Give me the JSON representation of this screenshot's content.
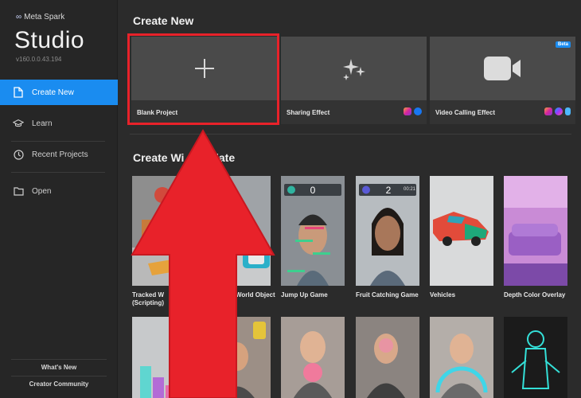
{
  "sidebar": {
    "brand": "Meta Spark",
    "title": "Studio",
    "version": "v160.0.0.43.194",
    "items": [
      {
        "label": "Create New",
        "icon": "document-icon"
      },
      {
        "label": "Learn",
        "icon": "graduation-cap-icon"
      },
      {
        "label": "Recent Projects",
        "icon": "clock-icon"
      },
      {
        "label": "Open",
        "icon": "folder-icon"
      }
    ],
    "footer": [
      {
        "label": "What's New"
      },
      {
        "label": "Creator Community"
      }
    ]
  },
  "main": {
    "create_new_title": "Create New",
    "create_new_cards": [
      {
        "label": "Blank Project",
        "icon": "plus-icon"
      },
      {
        "label": "Sharing Effect",
        "icon": "sparkles-icon",
        "badges": [
          "instagram-icon",
          "facebook-icon"
        ]
      },
      {
        "label": "Video Calling Effect",
        "icon": "video-camera-icon",
        "badge": "Beta",
        "badges": [
          "instagram-icon",
          "messenger-icon",
          "portal-icon"
        ]
      }
    ],
    "template_title": "Create With Template",
    "template_title_visible": "Create Wi",
    "template_title_visible_tail": "plate",
    "templates": [
      {
        "label": "Tracked W",
        "label2": "(Scripting)"
      },
      {
        "label": "World Object"
      },
      {
        "label": "Jump Up Game",
        "score": "0"
      },
      {
        "label": "Fruit Catching Game",
        "score": "2",
        "timer": "00:21"
      },
      {
        "label": "Vehicles"
      },
      {
        "label": "Depth Color Overlay"
      }
    ]
  },
  "colors": {
    "accent": "#1a8cf0",
    "highlight": "#e8222a",
    "arrow": "#e8222a"
  }
}
